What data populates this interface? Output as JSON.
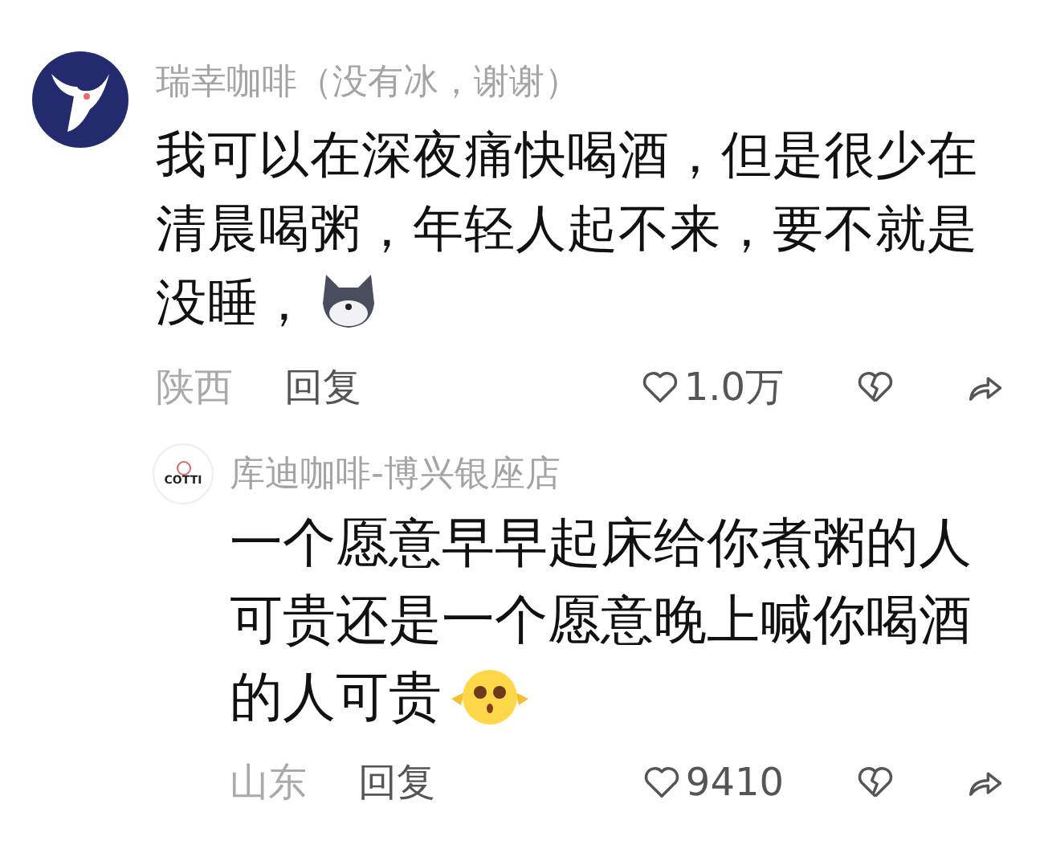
{
  "comments": [
    {
      "author": "瑞幸咖啡（没有冰，谢谢）",
      "avatar": {
        "kind": "deer"
      },
      "text": "我可以在深夜痛快喝酒，但是很少在清晨喝粥，年轻人起不来，要不就是没睡，",
      "sticker": {
        "kind": "dog"
      },
      "location": "陕西",
      "reply": "回复",
      "likes": "1.0万",
      "replies": [
        {
          "author": "库迪咖啡-博兴银座店",
          "avatar": {
            "kind": "logo",
            "label": "COTTI"
          },
          "text": "一个愿意早早起床给你煮粥的人可贵还是一个愿意晚上喊你喝酒的人可贵",
          "sticker": {
            "kind": "chick"
          },
          "location": "山东",
          "reply": "回复",
          "likes": "9410"
        }
      ]
    }
  ]
}
